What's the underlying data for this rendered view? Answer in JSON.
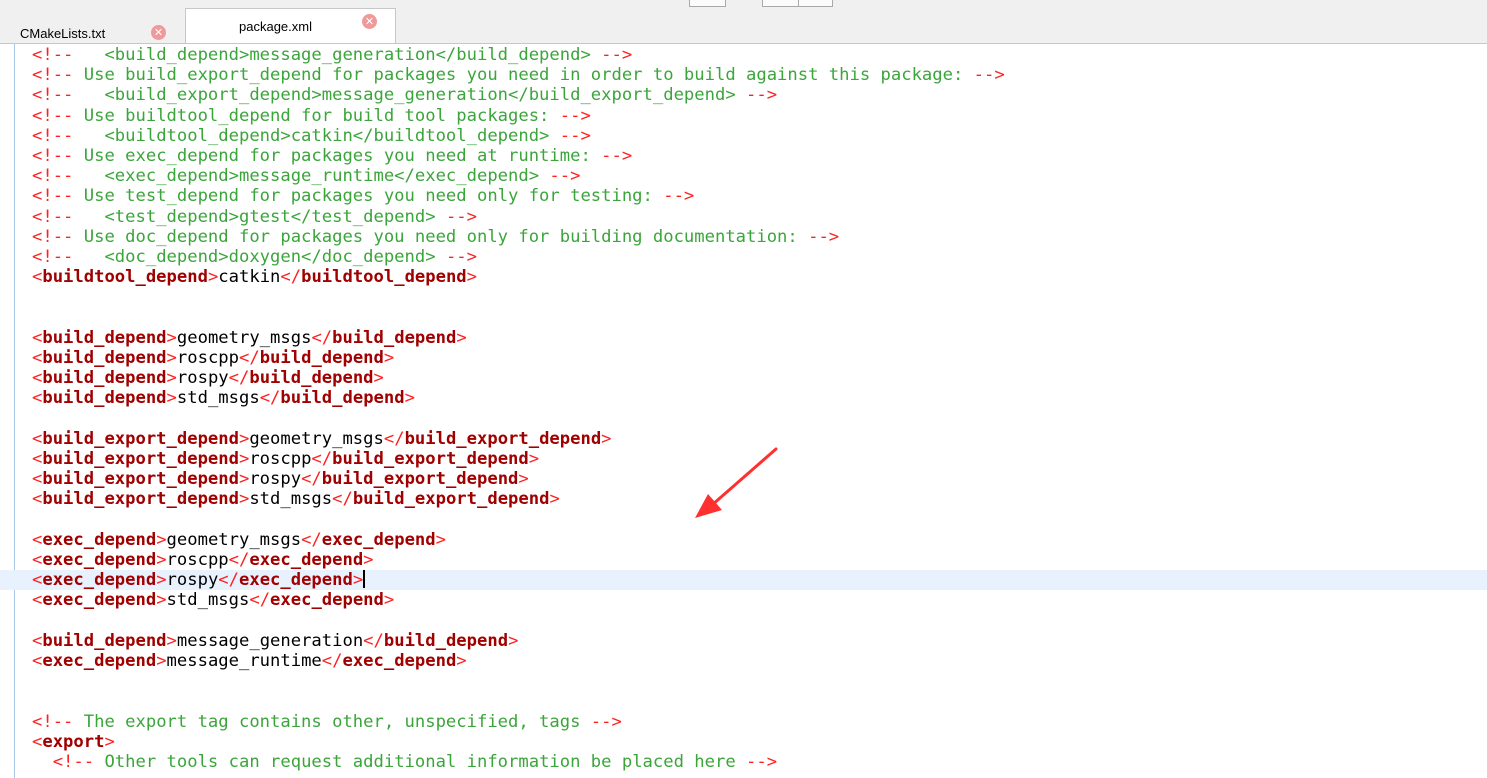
{
  "tabs": [
    {
      "label": "CMakeLists.txt",
      "active": false
    },
    {
      "label": "package.xml",
      "active": true
    }
  ],
  "editor": {
    "current_line": 27,
    "colors": {
      "comment_text": "#3ba53b",
      "comment_delimiter": "#ff2020",
      "tag_name": "#a00000",
      "tag_bracket": "#ff2020",
      "current_line_bg": "#e8f2fe",
      "annotation_arrow": "#ff3030"
    },
    "lines": [
      [
        [
          "cd",
          "<!--"
        ],
        [
          "cm",
          "   <build_depend>message_generation</build_depend> "
        ],
        [
          "cd",
          "-->"
        ]
      ],
      [
        [
          "cd",
          "<!--"
        ],
        [
          "cm",
          " Use build_export_depend for packages you need in order to build against this package: "
        ],
        [
          "cd",
          "-->"
        ]
      ],
      [
        [
          "cd",
          "<!--"
        ],
        [
          "cm",
          "   <build_export_depend>message_generation</build_export_depend> "
        ],
        [
          "cd",
          "-->"
        ]
      ],
      [
        [
          "cd",
          "<!--"
        ],
        [
          "cm",
          " Use buildtool_depend for build tool packages: "
        ],
        [
          "cd",
          "-->"
        ]
      ],
      [
        [
          "cd",
          "<!--"
        ],
        [
          "cm",
          "   <buildtool_depend>catkin</buildtool_depend> "
        ],
        [
          "cd",
          "-->"
        ]
      ],
      [
        [
          "cd",
          "<!--"
        ],
        [
          "cm",
          " Use exec_depend for packages you need at runtime: "
        ],
        [
          "cd",
          "-->"
        ]
      ],
      [
        [
          "cd",
          "<!--"
        ],
        [
          "cm",
          "   <exec_depend>message_runtime</exec_depend> "
        ],
        [
          "cd",
          "-->"
        ]
      ],
      [
        [
          "cd",
          "<!--"
        ],
        [
          "cm",
          " Use test_depend for packages you need only for testing: "
        ],
        [
          "cd",
          "-->"
        ]
      ],
      [
        [
          "cd",
          "<!--"
        ],
        [
          "cm",
          "   <test_depend>gtest</test_depend> "
        ],
        [
          "cd",
          "-->"
        ]
      ],
      [
        [
          "cd",
          "<!--"
        ],
        [
          "cm",
          " Use doc_depend for packages you need only for building documentation: "
        ],
        [
          "cd",
          "-->"
        ]
      ],
      [
        [
          "cd",
          "<!--"
        ],
        [
          "cm",
          "   <doc_depend>doxygen</doc_depend> "
        ],
        [
          "cd",
          "-->"
        ]
      ],
      [
        [
          "br",
          "<"
        ],
        [
          "tg",
          "buildtool_depend"
        ],
        [
          "br",
          ">"
        ],
        [
          "tx",
          "catkin"
        ],
        [
          "br",
          "</"
        ],
        [
          "tg",
          "buildtool_depend"
        ],
        [
          "br",
          ">"
        ]
      ],
      [],
      [],
      [
        [
          "br",
          "<"
        ],
        [
          "tg",
          "build_depend"
        ],
        [
          "br",
          ">"
        ],
        [
          "tx",
          "geometry_msgs"
        ],
        [
          "br",
          "</"
        ],
        [
          "tg",
          "build_depend"
        ],
        [
          "br",
          ">"
        ]
      ],
      [
        [
          "br",
          "<"
        ],
        [
          "tg",
          "build_depend"
        ],
        [
          "br",
          ">"
        ],
        [
          "tx",
          "roscpp"
        ],
        [
          "br",
          "</"
        ],
        [
          "tg",
          "build_depend"
        ],
        [
          "br",
          ">"
        ]
      ],
      [
        [
          "br",
          "<"
        ],
        [
          "tg",
          "build_depend"
        ],
        [
          "br",
          ">"
        ],
        [
          "tx",
          "rospy"
        ],
        [
          "br",
          "</"
        ],
        [
          "tg",
          "build_depend"
        ],
        [
          "br",
          ">"
        ]
      ],
      [
        [
          "br",
          "<"
        ],
        [
          "tg",
          "build_depend"
        ],
        [
          "br",
          ">"
        ],
        [
          "tx",
          "std_msgs"
        ],
        [
          "br",
          "</"
        ],
        [
          "tg",
          "build_depend"
        ],
        [
          "br",
          ">"
        ]
      ],
      [],
      [
        [
          "br",
          "<"
        ],
        [
          "tg",
          "build_export_depend"
        ],
        [
          "br",
          ">"
        ],
        [
          "tx",
          "geometry_msgs"
        ],
        [
          "br",
          "</"
        ],
        [
          "tg",
          "build_export_depend"
        ],
        [
          "br",
          ">"
        ]
      ],
      [
        [
          "br",
          "<"
        ],
        [
          "tg",
          "build_export_depend"
        ],
        [
          "br",
          ">"
        ],
        [
          "tx",
          "roscpp"
        ],
        [
          "br",
          "</"
        ],
        [
          "tg",
          "build_export_depend"
        ],
        [
          "br",
          ">"
        ]
      ],
      [
        [
          "br",
          "<"
        ],
        [
          "tg",
          "build_export_depend"
        ],
        [
          "br",
          ">"
        ],
        [
          "tx",
          "rospy"
        ],
        [
          "br",
          "</"
        ],
        [
          "tg",
          "build_export_depend"
        ],
        [
          "br",
          ">"
        ]
      ],
      [
        [
          "br",
          "<"
        ],
        [
          "tg",
          "build_export_depend"
        ],
        [
          "br",
          ">"
        ],
        [
          "tx",
          "std_msgs"
        ],
        [
          "br",
          "</"
        ],
        [
          "tg",
          "build_export_depend"
        ],
        [
          "br",
          ">"
        ]
      ],
      [],
      [
        [
          "br",
          "<"
        ],
        [
          "tg",
          "exec_depend"
        ],
        [
          "br",
          ">"
        ],
        [
          "tx",
          "geometry_msgs"
        ],
        [
          "br",
          "</"
        ],
        [
          "tg",
          "exec_depend"
        ],
        [
          "br",
          ">"
        ]
      ],
      [
        [
          "br",
          "<"
        ],
        [
          "tg",
          "exec_depend"
        ],
        [
          "br",
          ">"
        ],
        [
          "tx",
          "roscpp"
        ],
        [
          "br",
          "</"
        ],
        [
          "tg",
          "exec_depend"
        ],
        [
          "br",
          ">"
        ]
      ],
      [
        [
          "br",
          "<"
        ],
        [
          "tg",
          "exec_depend"
        ],
        [
          "br",
          ">"
        ],
        [
          "tx",
          "rospy"
        ],
        [
          "br",
          "</"
        ],
        [
          "tg",
          "exec_depend"
        ],
        [
          "br",
          ">"
        ]
      ],
      [
        [
          "br",
          "<"
        ],
        [
          "tg",
          "exec_depend"
        ],
        [
          "br",
          ">"
        ],
        [
          "tx",
          "std_msgs"
        ],
        [
          "br",
          "</"
        ],
        [
          "tg",
          "exec_depend"
        ],
        [
          "br",
          ">"
        ]
      ],
      [],
      [
        [
          "br",
          "<"
        ],
        [
          "tg",
          "build_depend"
        ],
        [
          "br",
          ">"
        ],
        [
          "tx",
          "message_generation"
        ],
        [
          "br",
          "</"
        ],
        [
          "tg",
          "build_depend"
        ],
        [
          "br",
          ">"
        ]
      ],
      [
        [
          "br",
          "<"
        ],
        [
          "tg",
          "exec_depend"
        ],
        [
          "br",
          ">"
        ],
        [
          "tx",
          "message_runtime"
        ],
        [
          "br",
          "</"
        ],
        [
          "tg",
          "exec_depend"
        ],
        [
          "br",
          ">"
        ]
      ],
      [],
      [],
      [
        [
          "cd",
          "<!--"
        ],
        [
          "cm",
          " The export tag contains other, unspecified, tags "
        ],
        [
          "cd",
          "-->"
        ]
      ],
      [
        [
          "br",
          "<"
        ],
        [
          "tg",
          "export"
        ],
        [
          "br",
          ">"
        ]
      ],
      [
        [
          "tx",
          "  "
        ],
        [
          "cd",
          "<!--"
        ],
        [
          "cm",
          " Other tools can request additional information be placed here "
        ],
        [
          "cd",
          "-->"
        ]
      ]
    ]
  }
}
